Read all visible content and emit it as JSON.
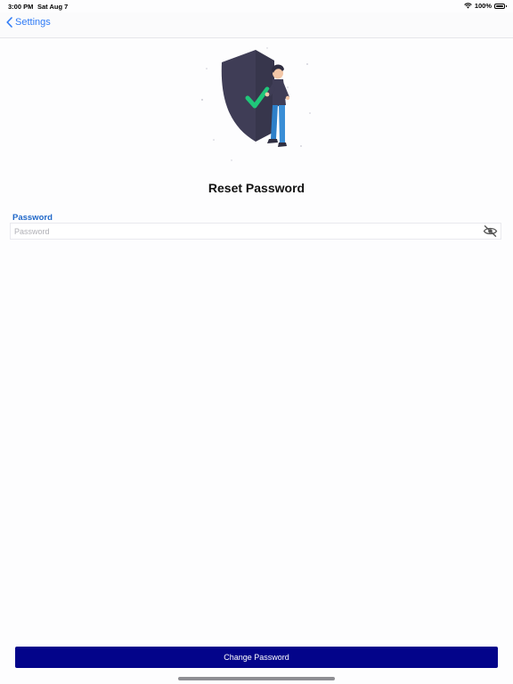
{
  "status_bar": {
    "time": "3:00 PM",
    "date": "Sat Aug 7",
    "battery": "100%",
    "icons": [
      "wifi-icon",
      "battery-icon"
    ]
  },
  "nav": {
    "back_label": "Settings",
    "back_icon": "chevron-left-icon"
  },
  "hero": {
    "illustration": "shield-check-person-illustration"
  },
  "page": {
    "title": "Reset Password"
  },
  "form": {
    "password": {
      "label": "Password",
      "placeholder": "Password",
      "value": "",
      "toggle_icon": "eye-slash-icon"
    }
  },
  "actions": {
    "submit_label": "Change Password"
  },
  "colors": {
    "accent": "#2f7bf6",
    "label": "#1f67c8",
    "button": "#03048a",
    "shield": "#3f3d56",
    "check": "#20c77a"
  }
}
